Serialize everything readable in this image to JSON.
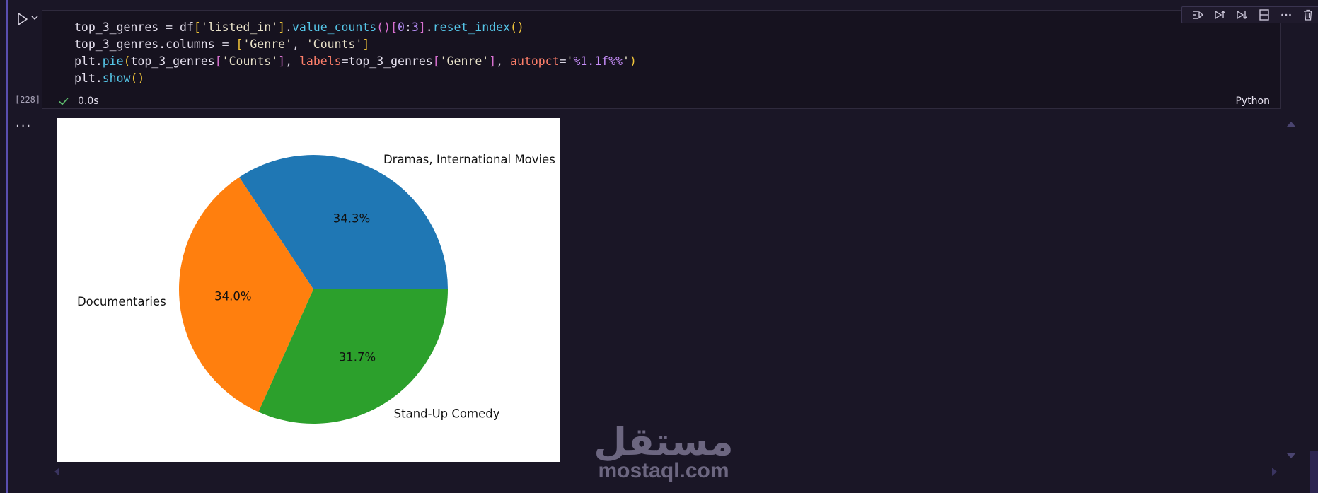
{
  "cell": {
    "execution_count": "[228]",
    "status_time": "0.0s",
    "language": "Python",
    "code_lines": [
      [
        {
          "t": "top_3_genres ",
          "c": ""
        },
        {
          "t": "= ",
          "c": "t-punc"
        },
        {
          "t": "df",
          "c": ""
        },
        {
          "t": "[",
          "c": "t-brk"
        },
        {
          "t": "'listed_in'",
          "c": "t-str"
        },
        {
          "t": "]",
          "c": "t-brk"
        },
        {
          "t": ".",
          "c": "t-punc"
        },
        {
          "t": "value_counts",
          "c": "t-fn"
        },
        {
          "t": "()",
          "c": "t-brk2"
        },
        {
          "t": "[",
          "c": "t-brk2"
        },
        {
          "t": "0",
          "c": "t-num"
        },
        {
          "t": ":",
          "c": "t-punc"
        },
        {
          "t": "3",
          "c": "t-num"
        },
        {
          "t": "]",
          "c": "t-brk2"
        },
        {
          "t": ".",
          "c": "t-punc"
        },
        {
          "t": "reset_index",
          "c": "t-fn"
        },
        {
          "t": "()",
          "c": "t-brk"
        }
      ],
      [
        {
          "t": "top_3_genres.columns ",
          "c": ""
        },
        {
          "t": "= ",
          "c": "t-punc"
        },
        {
          "t": "[",
          "c": "t-brk"
        },
        {
          "t": "'Genre'",
          "c": "t-str"
        },
        {
          "t": ", ",
          "c": "t-punc"
        },
        {
          "t": "'Counts'",
          "c": "t-str"
        },
        {
          "t": "]",
          "c": "t-brk"
        }
      ],
      [
        {
          "t": "plt.",
          "c": ""
        },
        {
          "t": "pie",
          "c": "t-fn"
        },
        {
          "t": "(",
          "c": "t-brk"
        },
        {
          "t": "top_3_genres",
          "c": ""
        },
        {
          "t": "[",
          "c": "t-brk2"
        },
        {
          "t": "'Counts'",
          "c": "t-str"
        },
        {
          "t": "]",
          "c": "t-brk2"
        },
        {
          "t": ", ",
          "c": "t-punc"
        },
        {
          "t": "labels",
          "c": "t-kw"
        },
        {
          "t": "=",
          "c": "t-punc"
        },
        {
          "t": "top_3_genres",
          "c": ""
        },
        {
          "t": "[",
          "c": "t-brk2"
        },
        {
          "t": "'Genre'",
          "c": "t-str"
        },
        {
          "t": "]",
          "c": "t-brk2"
        },
        {
          "t": ", ",
          "c": "t-punc"
        },
        {
          "t": "autopct",
          "c": "t-kw"
        },
        {
          "t": "=",
          "c": "t-punc"
        },
        {
          "t": "'",
          "c": "t-str"
        },
        {
          "t": "%1.1f%%",
          "c": "t-fmt"
        },
        {
          "t": "'",
          "c": "t-str"
        },
        {
          "t": ")",
          "c": "t-brk"
        }
      ],
      [
        {
          "t": "plt.",
          "c": ""
        },
        {
          "t": "show",
          "c": "t-fn"
        },
        {
          "t": "()",
          "c": "t-brk"
        }
      ]
    ]
  },
  "toolbar": {
    "icons": [
      "run-by-line-icon",
      "execute-above-icon",
      "execute-below-icon",
      "split-cell-icon",
      "more-actions-icon",
      "delete-cell-icon"
    ]
  },
  "output": {
    "menu_glyph": "···"
  },
  "chart_data": {
    "type": "pie",
    "categories": [
      "Dramas, International Movies",
      "Documentaries",
      "Stand-Up Comedy"
    ],
    "values": [
      34.3,
      34.0,
      31.7
    ],
    "labels_pct": [
      "34.3%",
      "34.0%",
      "31.7%"
    ],
    "colors": [
      "#1f77b4",
      "#ff7f0e",
      "#2ca02c"
    ],
    "startangle": 0,
    "counterclock": true,
    "title": "",
    "legend": "none"
  },
  "watermark": {
    "arabic": "مستقل",
    "latin": "mostaql.com"
  }
}
